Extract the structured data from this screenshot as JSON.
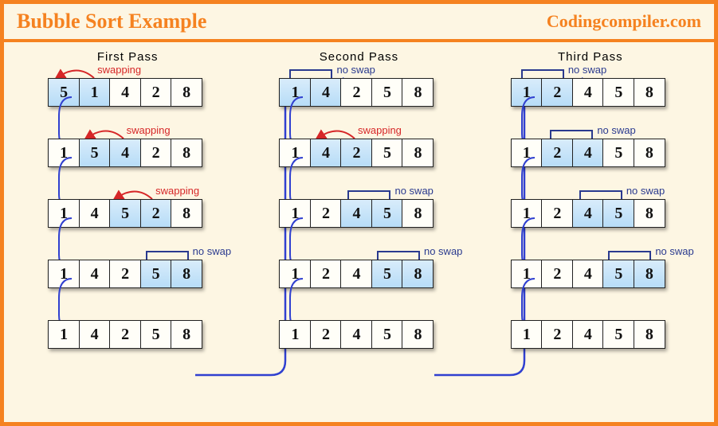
{
  "header": {
    "title": "Bubble Sort Example",
    "brand": "Codingcompiler.com"
  },
  "colors": {
    "accent": "#f58220",
    "flow_arrow": "#3040d0",
    "swap_arrow": "#d62728",
    "noswap_bracket": "#2a3a8f",
    "highlight_cell": "#c8e4fa"
  },
  "labels": {
    "swapping": "swapping",
    "noswap": "no swap"
  },
  "passes": [
    {
      "title": "First  Pass",
      "steps": [
        {
          "values": [
            5,
            1,
            4,
            2,
            8
          ],
          "highlight": [
            0,
            1
          ],
          "action": "swapping"
        },
        {
          "values": [
            1,
            5,
            4,
            2,
            8
          ],
          "highlight": [
            1,
            2
          ],
          "action": "swapping"
        },
        {
          "values": [
            1,
            4,
            5,
            2,
            8
          ],
          "highlight": [
            2,
            3
          ],
          "action": "swapping"
        },
        {
          "values": [
            1,
            4,
            2,
            5,
            8
          ],
          "highlight": [
            3,
            4
          ],
          "action": "no swap"
        },
        {
          "values": [
            1,
            4,
            2,
            5,
            8
          ],
          "highlight": [],
          "action": null
        }
      ]
    },
    {
      "title": "Second  Pass",
      "steps": [
        {
          "values": [
            1,
            4,
            2,
            5,
            8
          ],
          "highlight": [
            0,
            1
          ],
          "action": "no swap"
        },
        {
          "values": [
            1,
            4,
            2,
            5,
            8
          ],
          "highlight": [
            1,
            2
          ],
          "action": "swapping"
        },
        {
          "values": [
            1,
            2,
            4,
            5,
            8
          ],
          "highlight": [
            2,
            3
          ],
          "action": "no swap"
        },
        {
          "values": [
            1,
            2,
            4,
            5,
            8
          ],
          "highlight": [
            3,
            4
          ],
          "action": "no swap"
        },
        {
          "values": [
            1,
            2,
            4,
            5,
            8
          ],
          "highlight": [],
          "action": null
        }
      ]
    },
    {
      "title": "Third  Pass",
      "steps": [
        {
          "values": [
            1,
            2,
            4,
            5,
            8
          ],
          "highlight": [
            0,
            1
          ],
          "action": "no swap"
        },
        {
          "values": [
            1,
            2,
            4,
            5,
            8
          ],
          "highlight": [
            1,
            2
          ],
          "action": "no swap"
        },
        {
          "values": [
            1,
            2,
            4,
            5,
            8
          ],
          "highlight": [
            2,
            3
          ],
          "action": "no swap"
        },
        {
          "values": [
            1,
            2,
            4,
            5,
            8
          ],
          "highlight": [
            3,
            4
          ],
          "action": "no swap"
        },
        {
          "values": [
            1,
            2,
            4,
            5,
            8
          ],
          "highlight": [],
          "action": null
        }
      ]
    }
  ]
}
